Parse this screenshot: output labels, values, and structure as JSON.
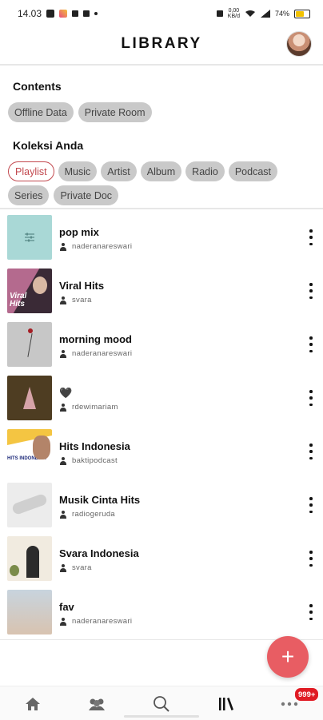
{
  "status_bar": {
    "time": "14.03",
    "speed": "0,00\nKB/d",
    "battery_pct": "74%",
    "battery_level": 0.74
  },
  "header": {
    "title": "LIBRARY"
  },
  "contents": {
    "label": "Contents",
    "chips": [
      "Offline Data",
      "Private Room"
    ]
  },
  "koleksi": {
    "label": "Koleksi Anda",
    "chips_row1": [
      "Playlist",
      "Music",
      "Artist",
      "Album",
      "Radio",
      "Podcast"
    ],
    "chips_row2": [
      "Series",
      "Private Doc"
    ],
    "active": "Playlist"
  },
  "playlists": [
    {
      "title": "pop mix",
      "owner": "naderanareswari"
    },
    {
      "title": "Viral Hits",
      "owner": "svara"
    },
    {
      "title": "morning mood",
      "owner": "naderanareswari"
    },
    {
      "title": "🖤",
      "owner": "rdewimariam"
    },
    {
      "title": "Hits Indonesia",
      "owner": "baktipodcast"
    },
    {
      "title": "Musik Cinta Hits",
      "owner": "radiogeruda"
    },
    {
      "title": "Svara Indonesia",
      "owner": "svara"
    },
    {
      "title": "fav",
      "owner": "naderanareswari"
    }
  ],
  "thumbs": {
    "pop_mix_text": "",
    "viral_hits_text": "Viral Hits",
    "hits_indonesia_text": "HITS INDONESIA"
  },
  "fab": {
    "symbol": "+"
  },
  "bottom_nav": {
    "items": [
      "home-icon",
      "community-icon",
      "search-icon",
      "library-icon",
      "more-icon"
    ],
    "badge": "999+"
  },
  "colors": {
    "accent": "#e85d63",
    "active_chip": "#c2484e",
    "chip_bg": "#c9c9c9"
  }
}
